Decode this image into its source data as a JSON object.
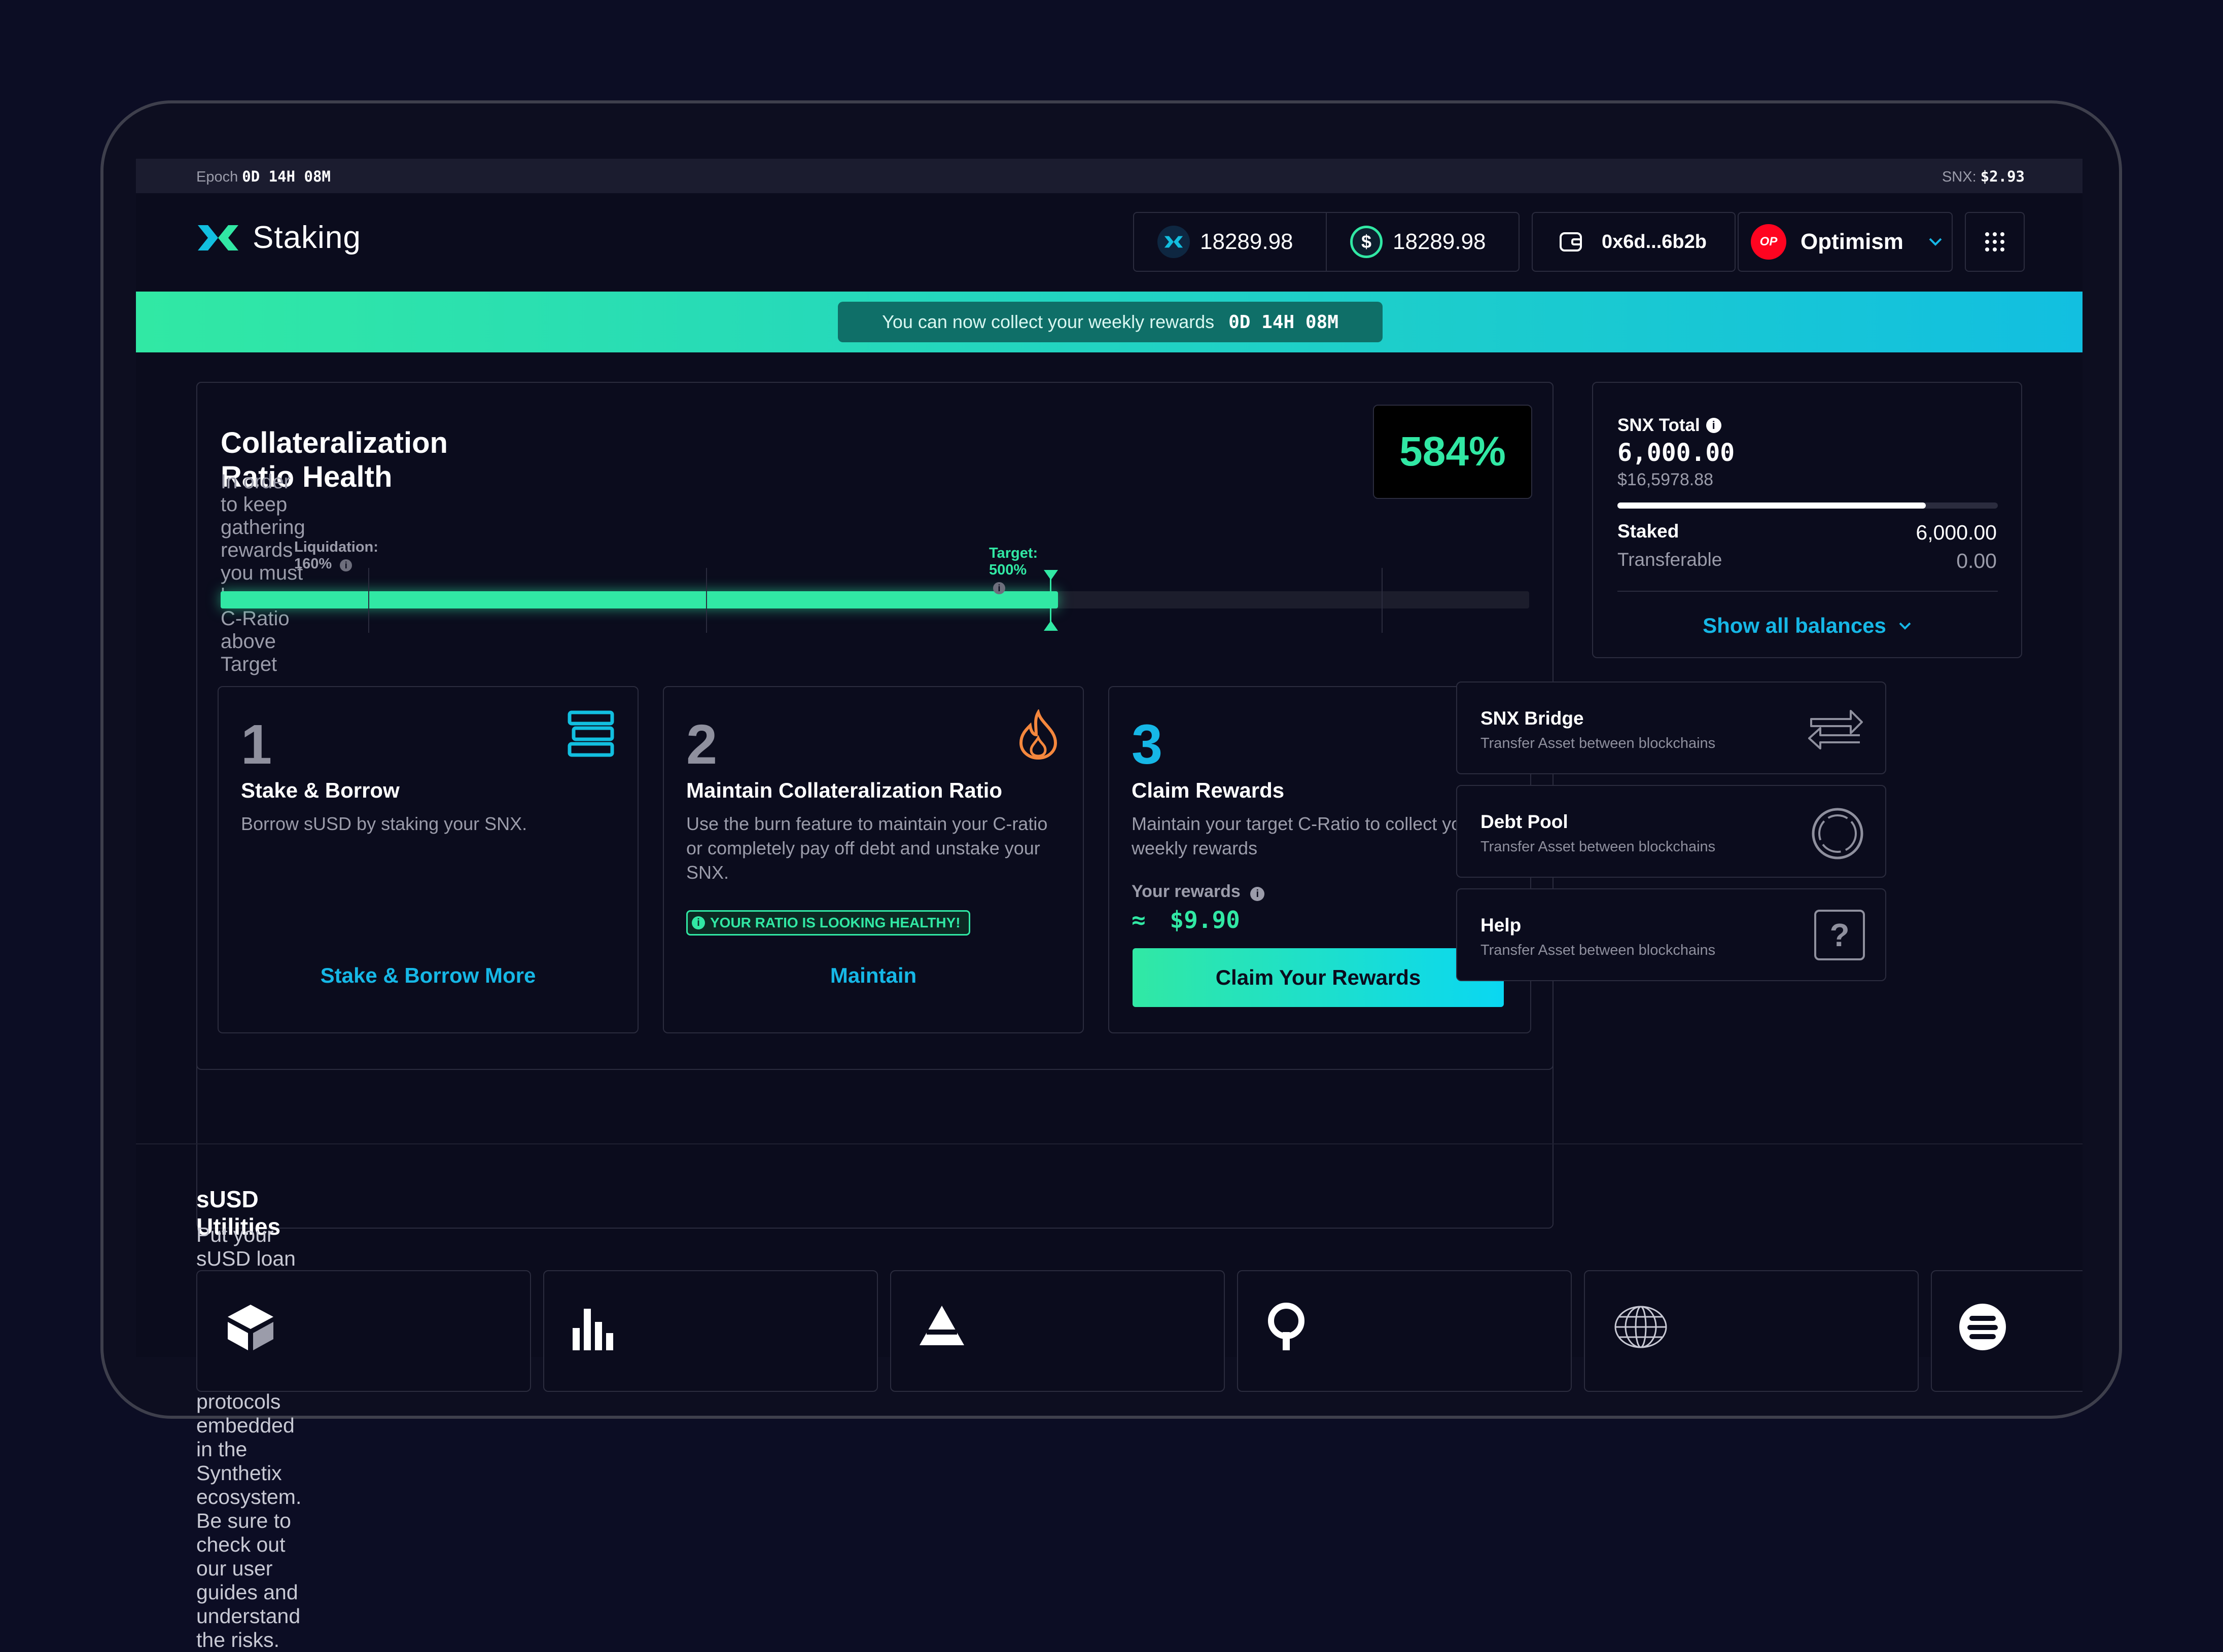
{
  "topbar": {
    "epoch_label": "Epoch",
    "epoch_value": "0D 14H 08M",
    "snx_label": "SNX:",
    "snx_price": "$2.93"
  },
  "header": {
    "app_title": "Staking",
    "snx_balance": "18289.98",
    "susd_balance": "18289.98",
    "wallet_address": "0x6d...6b2b",
    "network_badge": "OP",
    "network_name": "Optimism"
  },
  "banner": {
    "text": "You can now collect your weekly rewards",
    "countdown": "0D 14H 08M"
  },
  "health": {
    "title": "Collateralization Ratio Health",
    "subtitle": "In order to keep gathering rewards you must keep you C-Ratio above Target",
    "ratio": "584%",
    "liquidation_label": "Liquidation: 160%",
    "target_label": "Target: 500%",
    "progress_fraction": 0.64
  },
  "cards": [
    {
      "number": "1",
      "title": "Stake & Borrow",
      "description": "Borrow sUSD by staking your SNX.",
      "action": "Stake & Borrow More"
    },
    {
      "number": "2",
      "title": "Maintain Collateralization Ratio",
      "description": "Use the burn feature to maintain your C-ratio or completely pay off debt and unstake your SNX.",
      "badge": "YOUR RATIO IS LOOKING HEALTHY!",
      "action": "Maintain"
    },
    {
      "number": "3",
      "title": "Claim Rewards",
      "description": "Maintain your target C-Ratio to collect your weekly rewards",
      "rewards_label": "Your rewards",
      "rewards_approx": "≈",
      "rewards_value": "$9.90",
      "action": "Claim Your Rewards"
    }
  ],
  "balances": {
    "title": "SNX Total",
    "total": "6,000.00",
    "total_usd": "$16,5978.88",
    "staked_fraction": 0.81,
    "staked_label": "Staked",
    "staked_value": "6,000.00",
    "transferable_label": "Transferable",
    "transferable_value": "0.00",
    "show_all": "Show all balances"
  },
  "side_links": [
    {
      "title": "SNX Bridge",
      "description": "Transfer Asset between blockchains",
      "icon": "arrows-exchange-icon"
    },
    {
      "title": "Debt Pool",
      "description": "Transfer Asset between blockchains",
      "icon": "ring-icon"
    },
    {
      "title": "Help",
      "description": "Transfer Asset between blockchains",
      "icon": "question-icon"
    }
  ],
  "utilities": {
    "title": "sUSD Utilities",
    "description": "Put your sUSD loan to work buy utalizing one or more protocols embedded in the Synthetix ecosystem. Be sure to check out our user guides and understand the risks."
  },
  "colors": {
    "background": "#0b0c1d",
    "accent_green": "#31e8a4",
    "accent_cyan": "#12bfe0",
    "link_blue": "#16b7e6",
    "warning_orange": "#f5873d",
    "network_red": "#ff0420"
  }
}
